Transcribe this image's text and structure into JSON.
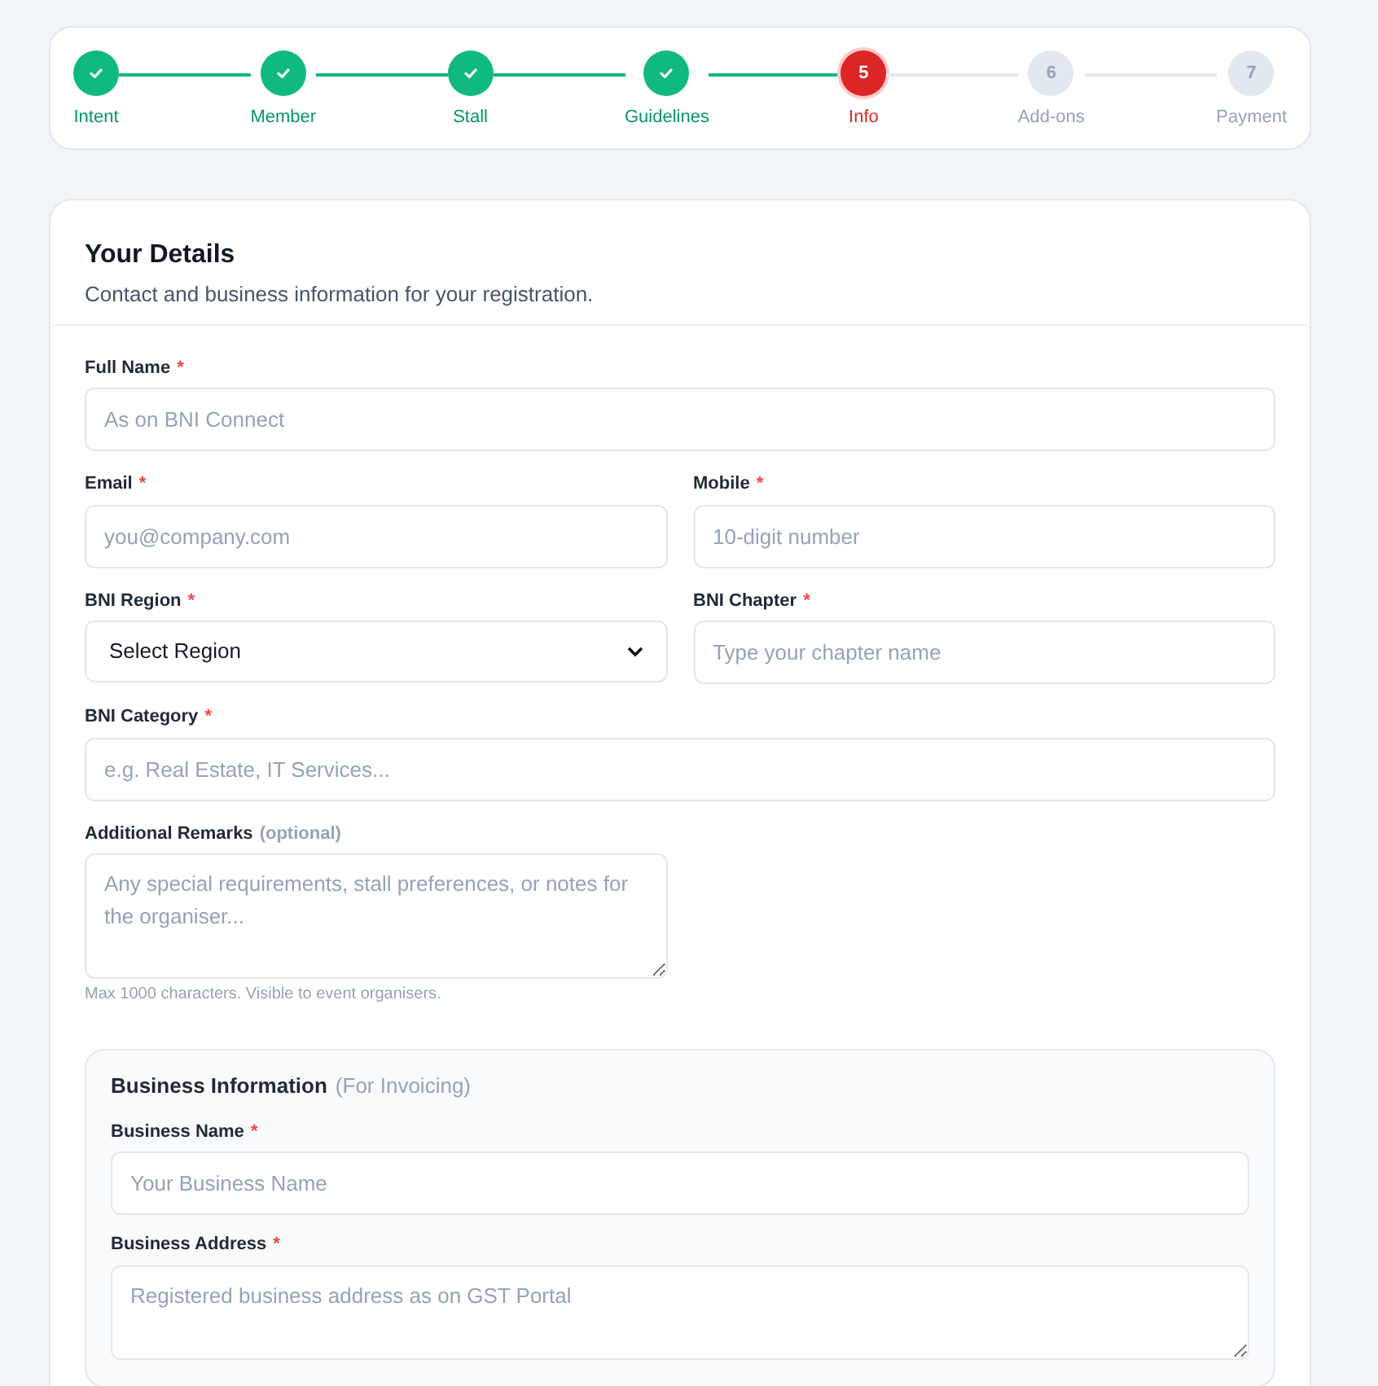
{
  "steps": [
    {
      "label": "Intent",
      "done": true,
      "current": false
    },
    {
      "label": "Member",
      "done": true,
      "current": false
    },
    {
      "label": "Stall",
      "done": true,
      "current": false
    },
    {
      "label": "Guidelines",
      "done": true,
      "current": false
    },
    {
      "number": "5",
      "label": "Info",
      "done": false,
      "current": true
    },
    {
      "number": "6",
      "label": "Add-ons",
      "done": false,
      "current": false
    },
    {
      "number": "7",
      "label": "Payment",
      "done": false,
      "current": false
    }
  ],
  "details": {
    "title": "Your Details",
    "subtitle": "Contact and business information for your registration.",
    "rows": [
      [
        {
          "label": "Full Name",
          "required_mark": "*",
          "kind": "text",
          "placeholder": "As on BNI Connect"
        }
      ],
      [
        {
          "label": "Email",
          "required_mark": "*",
          "kind": "text",
          "placeholder": "you@company.com"
        },
        {
          "label": "Mobile",
          "required_mark": "*",
          "kind": "text",
          "placeholder": "10-digit number"
        }
      ],
      [
        {
          "label": "BNI Region",
          "required_mark": "*",
          "kind": "select",
          "value": "Select Region"
        },
        {
          "label": "BNI Chapter",
          "required_mark": "*",
          "kind": "text",
          "placeholder": "Type your chapter name"
        }
      ],
      [
        {
          "label": "BNI Category",
          "required_mark": "*",
          "kind": "text",
          "placeholder": "e.g. Real Estate, IT Services..."
        }
      ],
      [
        {
          "label": "Additional Remarks",
          "optional_note": "(optional)",
          "kind": "textarea",
          "placeholder": "Any special requirements, stall preferences, or notes for the organiser...",
          "help": "Max 1000 characters. Visible to event organisers."
        }
      ]
    ]
  },
  "business": {
    "title": "Business Information",
    "title_note": "(For Invoicing)",
    "fields": [
      {
        "label": "Business Name",
        "required_mark": "*",
        "kind": "text",
        "placeholder": "Your Business Name"
      },
      {
        "label": "Business Address",
        "required_mark": "*",
        "kind": "textarea",
        "placeholder": "Registered business address as on GST Portal"
      }
    ]
  }
}
